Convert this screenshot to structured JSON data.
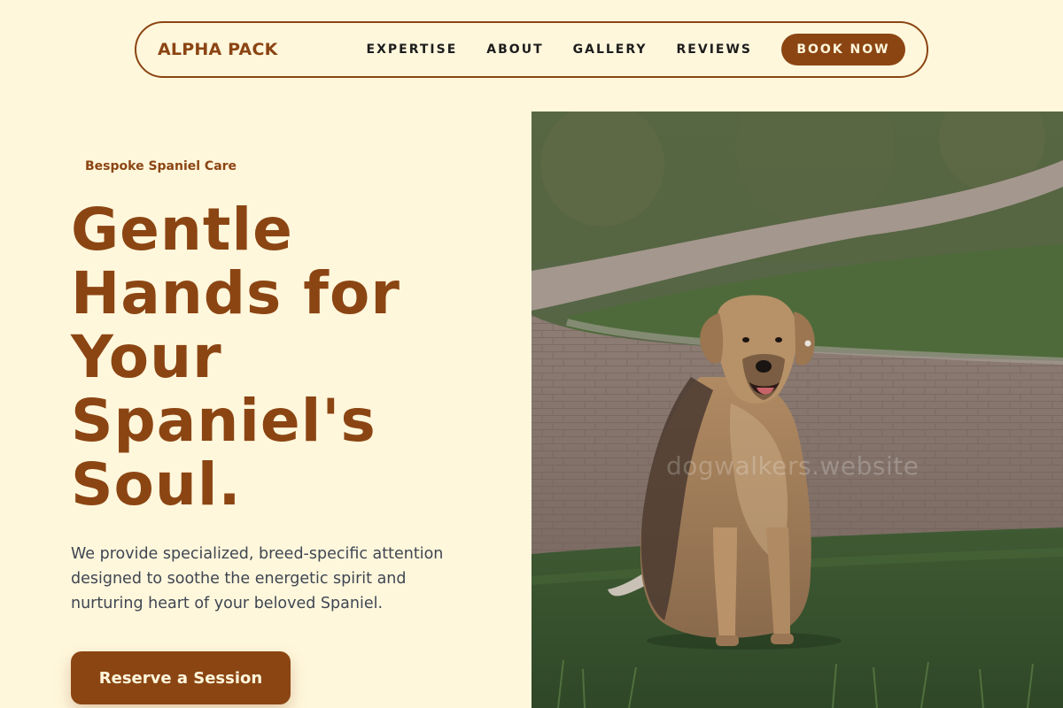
{
  "nav": {
    "brand": "ALPHA PACK",
    "links": [
      "EXPERTISE",
      "ABOUT",
      "GALLERY",
      "REVIEWS"
    ],
    "book_label": "BOOK NOW"
  },
  "hero": {
    "eyebrow": "Bespoke Spaniel Care",
    "headline_lines": [
      "Gentle",
      "Hands for",
      "Your",
      "Spaniel's",
      "Soul."
    ],
    "lede": "We provide specialized, breed-specific attention designed to soothe the energetic spirit and nurturing heart of your beloved Spaniel.",
    "cta_label": "Reserve a Session"
  },
  "image": {
    "subject": "dog-sitting-on-grass-photo",
    "watermark": "dogwalkers.website"
  },
  "colors": {
    "background": "#FFF7DC",
    "brand": "#8B4513",
    "body_text": "#3f4652"
  }
}
